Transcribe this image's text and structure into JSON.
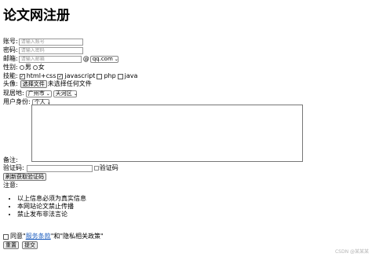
{
  "title": "论文网注册",
  "account": {
    "label": "账号:",
    "placeholder": "请输入账号"
  },
  "password": {
    "label": "密码:",
    "placeholder": "请输入密码"
  },
  "email": {
    "label": "邮箱:",
    "placeholder": "请输入邮箱",
    "at": "@",
    "domain": "qq.com"
  },
  "gender": {
    "label": "性别:",
    "options": [
      "男",
      "女"
    ]
  },
  "skills": {
    "label": "技能:",
    "options": [
      {
        "label": "html+css",
        "checked": true
      },
      {
        "label": "javascript",
        "checked": true
      },
      {
        "label": "php",
        "checked": false
      },
      {
        "label": "java",
        "checked": false
      }
    ]
  },
  "avatar": {
    "label": "头像:",
    "button": "选择文件",
    "status": "未选择任何文件"
  },
  "location": {
    "label": "现居地:",
    "city": "广州市",
    "district": "天河区"
  },
  "identity": {
    "label": "用户身份:",
    "value": "个人"
  },
  "remark": {
    "label": "备注:"
  },
  "captcha": {
    "label": "验证码:",
    "img_alt": "验证码",
    "refresh": "刷新获取验证码"
  },
  "notice": {
    "label": "注意:",
    "items": [
      "以上信息必须为真实信息",
      "本网站论文禁止传播",
      "禁止发布非法言论"
    ]
  },
  "agree": {
    "prefix": "同意\"",
    "link": "服务条款",
    "middle": "\"和\"隐私相关政策\""
  },
  "buttons": {
    "reset": "重置",
    "submit": "提交"
  },
  "watermark": "CSDN @某某某"
}
